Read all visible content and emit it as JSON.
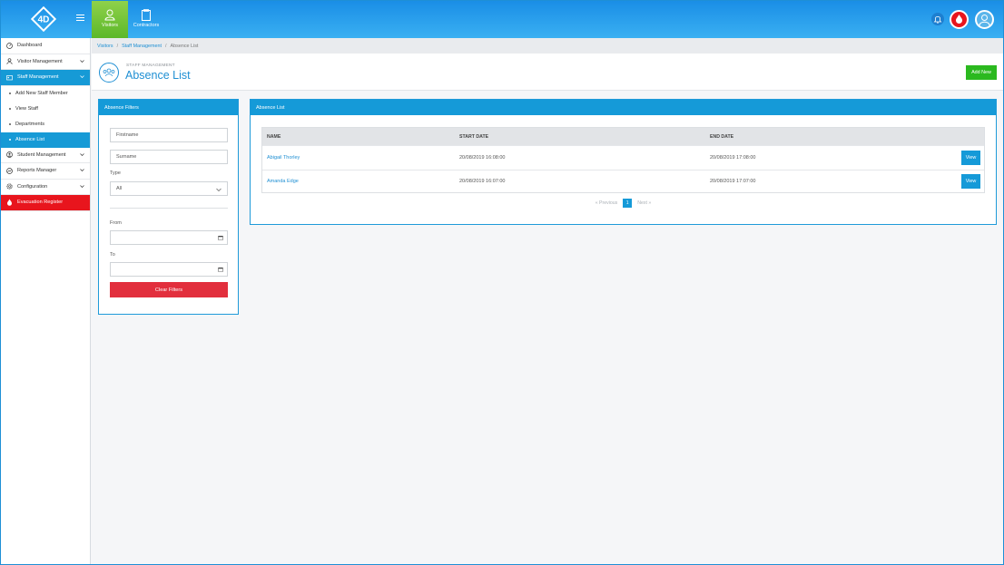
{
  "topbar": {
    "logo_text": "4D",
    "tabs": [
      {
        "label": "Visitors",
        "icon": "visitor-icon",
        "active": true
      },
      {
        "label": "Contractors",
        "icon": "clipboard-icon",
        "active": false
      }
    ]
  },
  "sidebar": {
    "items": [
      {
        "label": "Dashboard",
        "icon": "dashboard-icon"
      },
      {
        "label": "Visitor Management",
        "icon": "user-icon"
      },
      {
        "label": "Staff Management",
        "icon": "staff-icon"
      },
      {
        "label": "Add New Staff Member"
      },
      {
        "label": "View Staff"
      },
      {
        "label": "Departments"
      },
      {
        "label": "Absence List"
      },
      {
        "label": "Student Management",
        "icon": "student-icon"
      },
      {
        "label": "Reports Manager",
        "icon": "reports-icon"
      },
      {
        "label": "Configuration",
        "icon": "settings-icon"
      },
      {
        "label": "Evacuation Register",
        "icon": "flame-icon"
      }
    ]
  },
  "breadcrumb": [
    "Visitors",
    "Staff Management",
    "Absence List"
  ],
  "header": {
    "supertitle": "STAFF MANAGEMENT",
    "title": "Absence List",
    "add_new": "Add New"
  },
  "filters": {
    "title": "Absence Filters",
    "firstname_placeholder": "Firstname",
    "surname_placeholder": "Surname",
    "type_label": "Type",
    "type_value": "All",
    "from_label": "From",
    "to_label": "To",
    "clear": "Clear Filters"
  },
  "list": {
    "title": "Absence List",
    "columns": [
      "NAME",
      "START DATE",
      "END DATE"
    ],
    "rows": [
      {
        "name": "Abigail Thorley",
        "start": "20/08/2019 16:08:00",
        "end": "20/08/2019 17:08:00",
        "action": "View"
      },
      {
        "name": "Amanda Edge",
        "start": "20/08/2019 16:07:00",
        "end": "20/08/2019 17:07:00",
        "action": "View"
      }
    ],
    "pagination": {
      "previous": "« Previous",
      "page": "1",
      "next": "Next »"
    }
  },
  "colors": {
    "primary": "#159ad8",
    "accent_green": "#2bb91f",
    "danger": "#e22f3d",
    "evac_red": "#e8151d"
  }
}
